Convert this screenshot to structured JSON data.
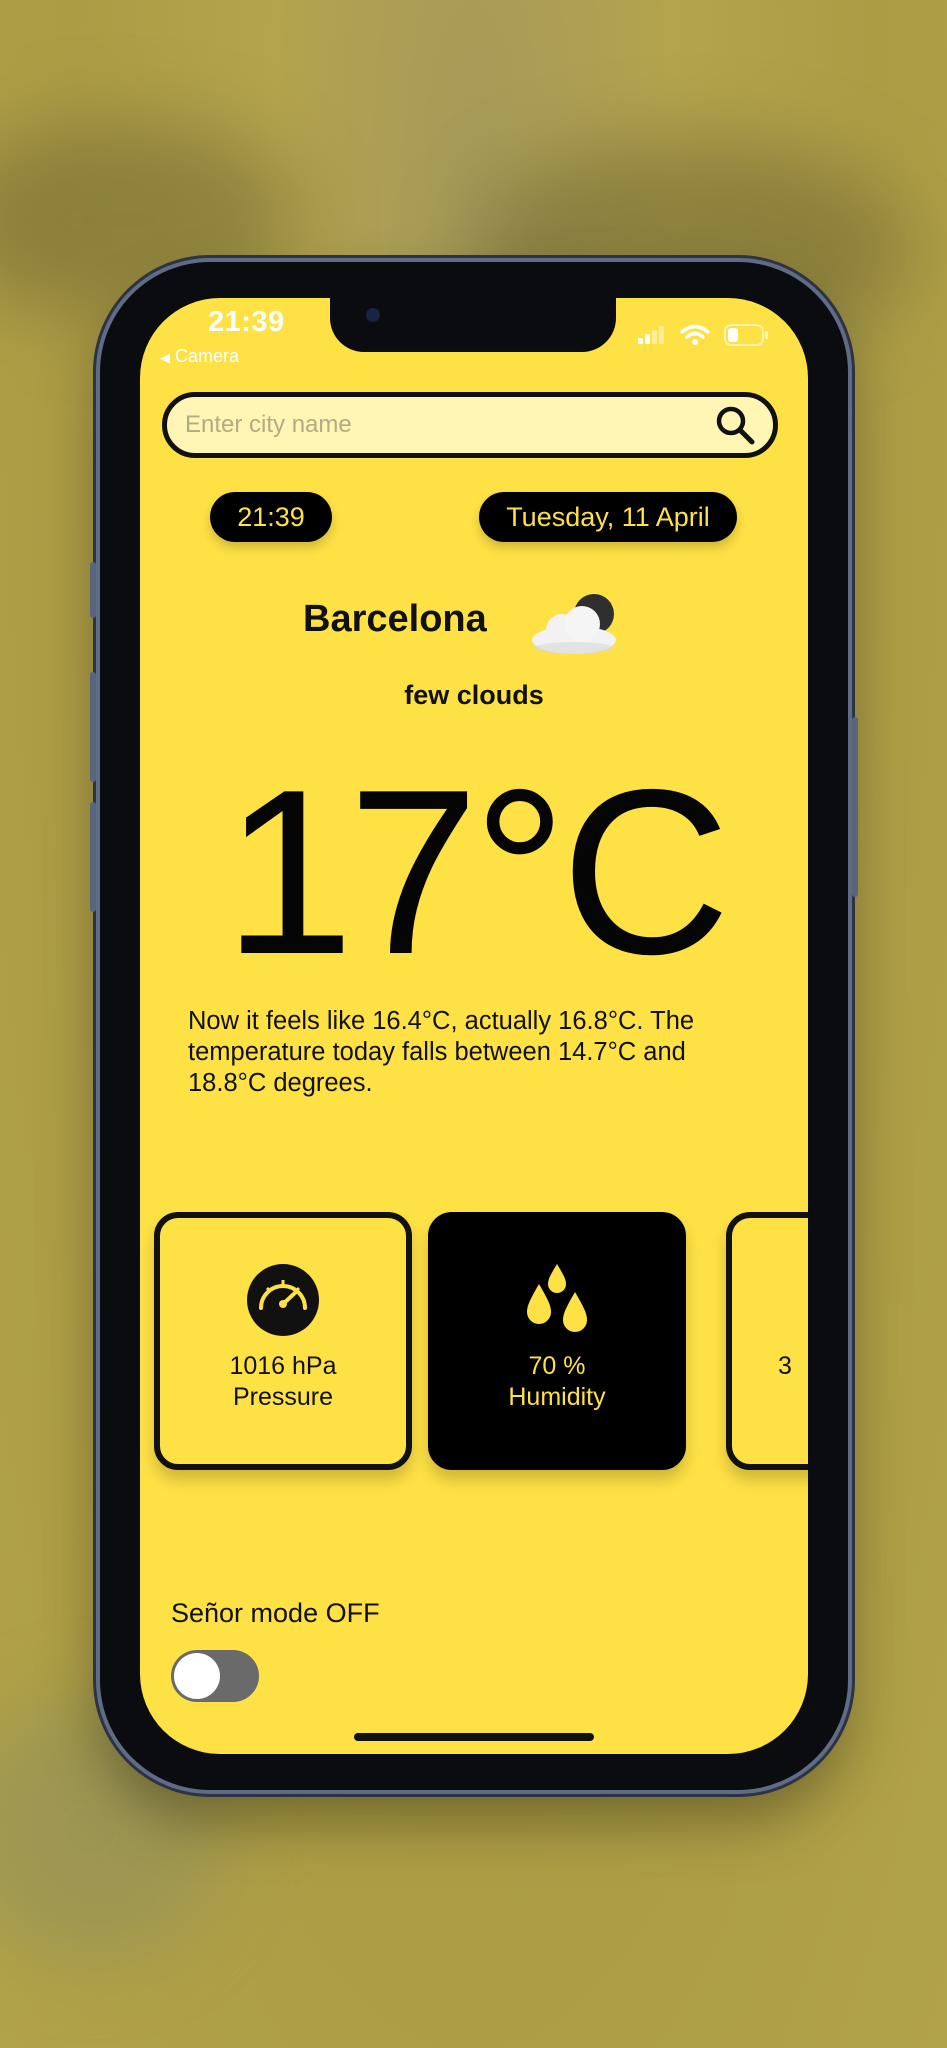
{
  "status_bar": {
    "time": "21:39",
    "back_label": "Camera"
  },
  "search": {
    "placeholder": "Enter city name",
    "value": ""
  },
  "info_pills": {
    "time": "21:39",
    "date": "Tuesday, 11 April"
  },
  "weather": {
    "city": "Barcelona",
    "icon": "few-clouds-night-icon",
    "description": "few clouds",
    "temperature": "17°C",
    "feels_text": "Now it feels like 16.4°C, actually 16.8°C. The temperature today falls between 14.7°C and 18.8°C degrees."
  },
  "cards": [
    {
      "icon": "gauge-icon",
      "value": "1016 hPa",
      "label": "Pressure",
      "theme": "light"
    },
    {
      "icon": "water-drops-icon",
      "value": "70 %",
      "label": "Humidity",
      "theme": "dark"
    },
    {
      "icon": "",
      "value": "3",
      "label": "",
      "theme": "light"
    }
  ],
  "senor_mode": {
    "label": "Señor mode OFF",
    "enabled": false
  },
  "colors": {
    "accent": "#fee145",
    "dark": "#000000",
    "input_bg": "#fff5b4",
    "toggle_off": "#6a6a6a"
  }
}
